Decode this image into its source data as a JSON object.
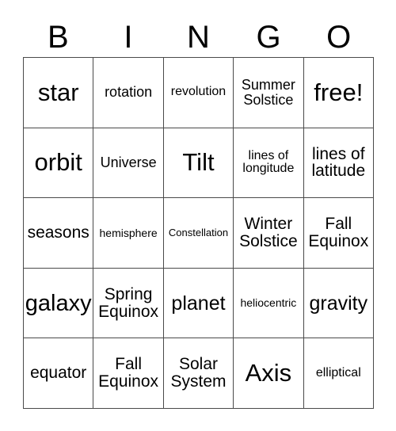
{
  "card": {
    "headers": [
      "B",
      "I",
      "N",
      "G",
      "O"
    ],
    "rows": [
      [
        {
          "text": "star",
          "size": "fs-xxl"
        },
        {
          "text": "rotation",
          "size": "fs-sm"
        },
        {
          "text": "revolution",
          "size": "fs-s"
        },
        {
          "text": "Summer Solstice",
          "size": "fs-sm"
        },
        {
          "text": "free!",
          "size": "fs-xxl"
        }
      ],
      [
        {
          "text": "orbit",
          "size": "fs-xxl"
        },
        {
          "text": "Universe",
          "size": "fs-sm"
        },
        {
          "text": "Tilt",
          "size": "fs-xxl"
        },
        {
          "text": "lines of longitude",
          "size": "fs-s"
        },
        {
          "text": "lines of latitude",
          "size": "fs-m"
        }
      ],
      [
        {
          "text": "seasons",
          "size": "fs-m"
        },
        {
          "text": "hemisphere",
          "size": "fs-xs"
        },
        {
          "text": "Constellation",
          "size": "fs-xxs"
        },
        {
          "text": "Winter Solstice",
          "size": "fs-m"
        },
        {
          "text": "Fall Equinox",
          "size": "fs-m"
        }
      ],
      [
        {
          "text": "galaxy",
          "size": "fs-xl"
        },
        {
          "text": "Spring Equinox",
          "size": "fs-m"
        },
        {
          "text": "planet",
          "size": "fs-l"
        },
        {
          "text": "heliocentric",
          "size": "fs-xs"
        },
        {
          "text": "gravity",
          "size": "fs-l"
        }
      ],
      [
        {
          "text": "equator",
          "size": "fs-m"
        },
        {
          "text": "Fall Equinox",
          "size": "fs-m"
        },
        {
          "text": "Solar System",
          "size": "fs-m"
        },
        {
          "text": "Axis",
          "size": "fs-xxl"
        },
        {
          "text": "elliptical",
          "size": "fs-s"
        }
      ]
    ],
    "colors": {
      "border": "#4a4a4a",
      "text": "#000000",
      "background": "#ffffff"
    }
  }
}
